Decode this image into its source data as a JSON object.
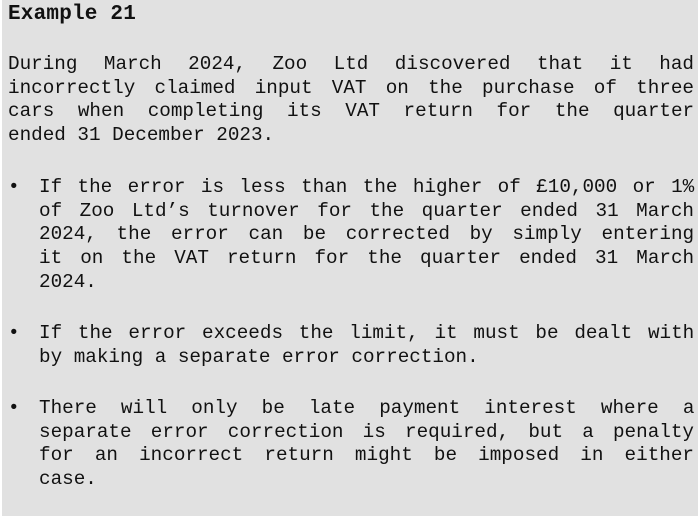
{
  "title": "Example 21",
  "intro_lines": [
    "During March 2024, Zoo Ltd discovered that it had",
    "incorrectly claimed input VAT on the purchase of three",
    "cars when completing its VAT return for the quarter",
    "ended 31 December 2023."
  ],
  "bullet_glyph": "•",
  "bullets": [
    {
      "lines": [
        "If the error is less than the higher of £10,000 or 1%",
        "of Zoo Ltd’s turnover for the quarter ended 31 March",
        "2024, the error can be corrected by simply entering",
        "it on the VAT return for the quarter ended 31 March",
        "2024."
      ]
    },
    {
      "lines": [
        "If the error exceeds the limit, it must be dealt with",
        "by making a separate error correction."
      ]
    },
    {
      "lines": [
        "There will only be late payment interest where a",
        "separate error correction is required, but a penalty",
        "for an incorrect return might be imposed in either",
        "case."
      ]
    }
  ]
}
